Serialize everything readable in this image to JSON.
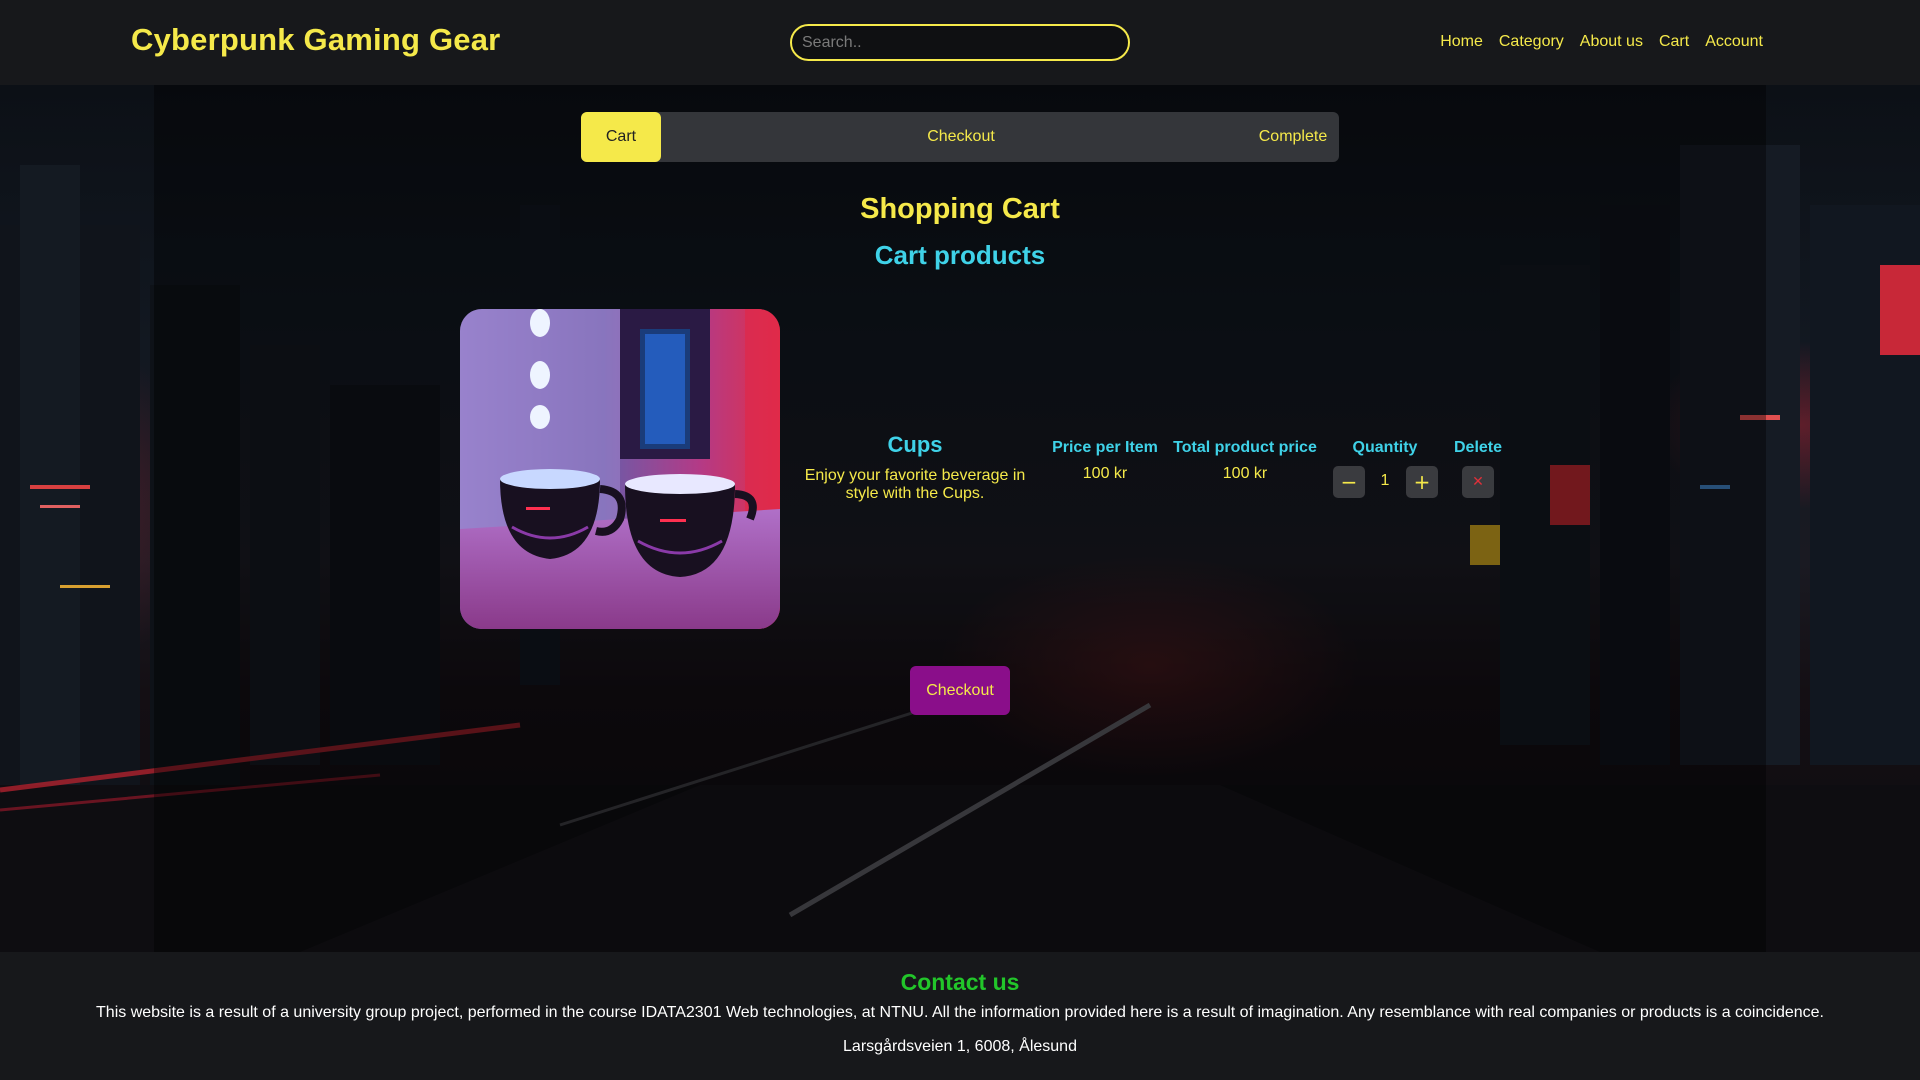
{
  "header": {
    "brand": "Cyberpunk Gaming Gear",
    "search_placeholder": "Search..",
    "nav": [
      "Home",
      "Category",
      "About us",
      "Cart",
      "Account"
    ]
  },
  "steps": {
    "items": [
      "Cart",
      "Checkout",
      "Complete"
    ],
    "active": "Cart"
  },
  "page": {
    "title": "Shopping Cart",
    "subtitle": "Cart products"
  },
  "cart": {
    "columns": {
      "price_per_item": "Price per Item",
      "total_price": "Total product price",
      "quantity": "Quantity",
      "delete": "Delete"
    },
    "items": [
      {
        "name": "Cups",
        "description": "Enjoy your favorite beverage in style with the Cups.",
        "price_per_item": "100 kr",
        "total_price": "100 kr",
        "quantity": "1",
        "decrement_symbol": "−",
        "increment_symbol": "+",
        "delete_symbol": "✕"
      }
    ],
    "checkout_label": "Checkout"
  },
  "footer": {
    "heading": "Contact us",
    "disclaimer": "This website is a result of a university group project, performed in the course IDATA2301 Web technologies, at NTNU. All the information provided here is a result of imagination. Any resemblance with real companies or products is a coincidence.",
    "address": "Larsgårdsveien 1, 6008, Ålesund"
  },
  "colors": {
    "accent_yellow": "#f5e94a",
    "accent_cyan": "#3fd2e8",
    "checkout_purple": "#8a0e8a",
    "contact_green": "#22c62a"
  }
}
